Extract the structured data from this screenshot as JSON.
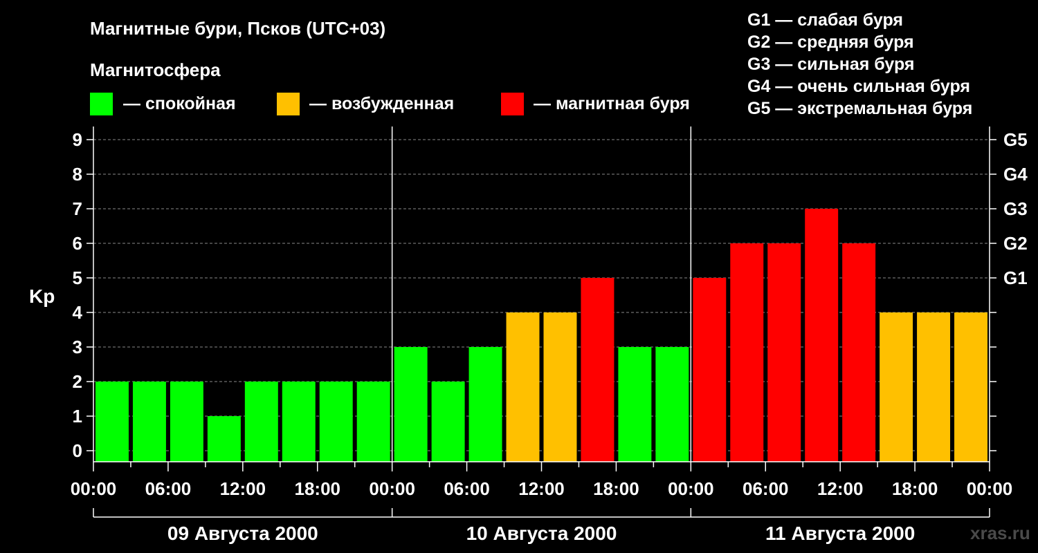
{
  "chart_data": {
    "type": "bar",
    "title": "Магнитные бури, Псков (UTC+03)",
    "legend_title": "Магнитосфера",
    "legend": [
      {
        "label": "— спокойная",
        "color": "#00ff00"
      },
      {
        "label": "— возбужденная",
        "color": "#ffc000"
      },
      {
        "label": "— магнитная буря",
        "color": "#ff0000"
      }
    ],
    "storm_scale": [
      "G1 — слабая буря",
      "G2 — средняя буря",
      "G3 — сильная буря",
      "G4 — очень сильная буря",
      "G5 — экстремальная буря"
    ],
    "ylabel": "Kp",
    "ylim": [
      0,
      9
    ],
    "y_ticks": [
      "0",
      "1",
      "2",
      "3",
      "4",
      "5",
      "6",
      "7",
      "8",
      "9"
    ],
    "right_ticks": [
      {
        "value": 5,
        "label": "G1"
      },
      {
        "value": 6,
        "label": "G2"
      },
      {
        "value": 7,
        "label": "G3"
      },
      {
        "value": 8,
        "label": "G4"
      },
      {
        "value": 9,
        "label": "G5"
      }
    ],
    "grid": true,
    "x_tick_labels": [
      "00:00",
      "06:00",
      "12:00",
      "18:00",
      "00:00",
      "06:00",
      "12:00",
      "18:00",
      "00:00",
      "06:00",
      "12:00",
      "18:00",
      "00:00"
    ],
    "days": [
      "09 Августа 2000",
      "10 Августа 2000",
      "11 Августа 2000"
    ],
    "values": [
      2,
      2,
      2,
      1,
      2,
      2,
      2,
      2,
      3,
      2,
      3,
      4,
      4,
      5,
      3,
      3,
      5,
      6,
      6,
      7,
      6,
      4,
      4,
      4
    ],
    "colors": {
      "calm": "#00ff00",
      "active": "#ffc000",
      "storm": "#ff0000"
    }
  },
  "watermark": "xras.ru"
}
